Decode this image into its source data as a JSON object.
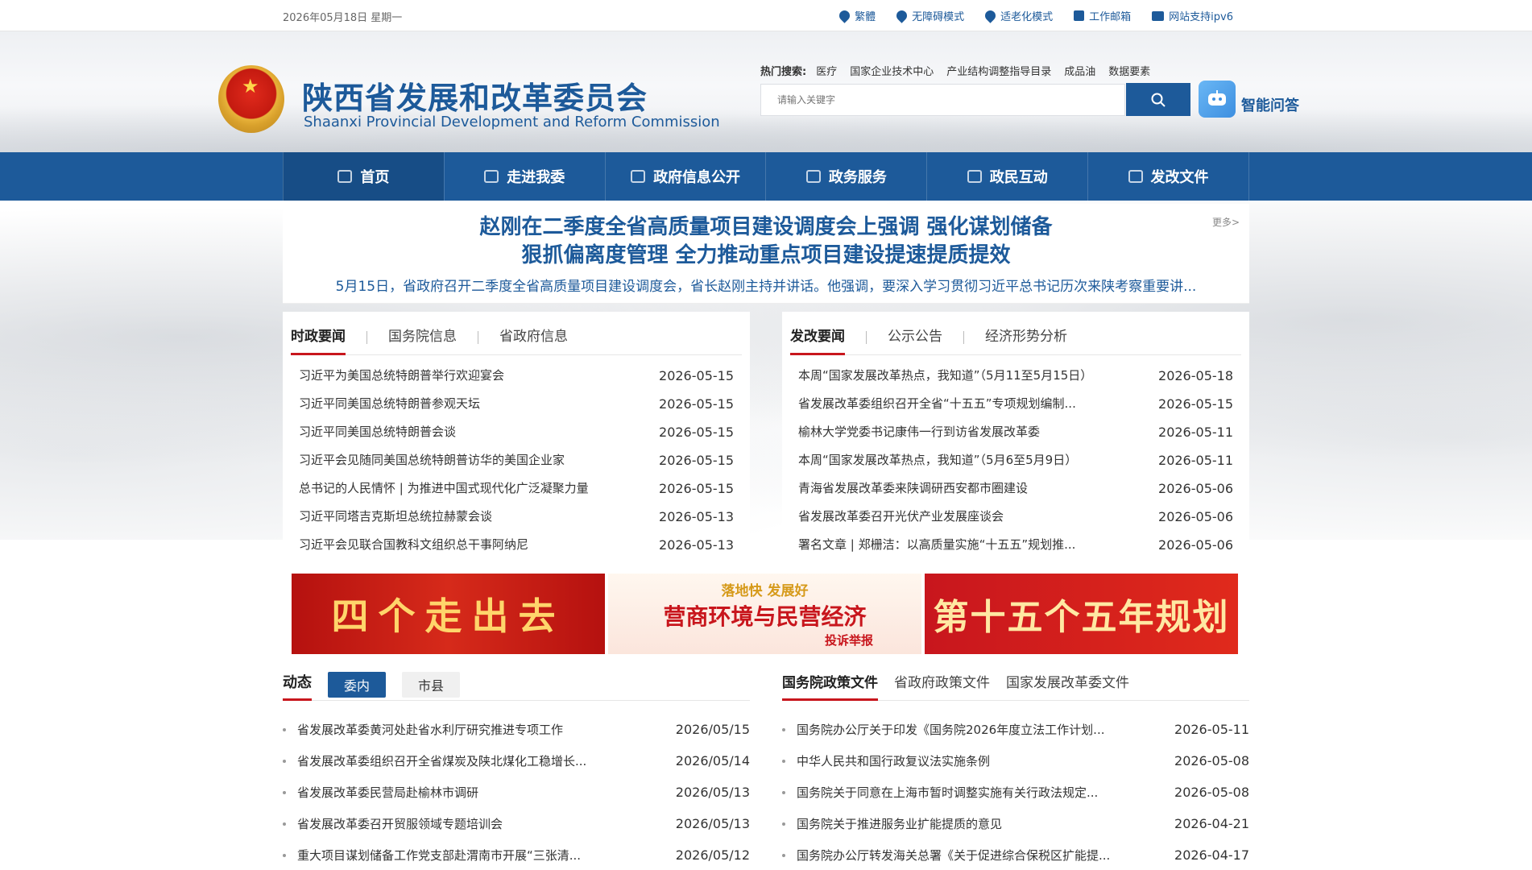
{
  "topbar": {
    "date": "2026年05月18日 星期一",
    "utils": [
      {
        "label": "繁體",
        "icon": "location-pin-icon"
      },
      {
        "label": "无障碍模式",
        "icon": "location-pin-icon"
      },
      {
        "label": "适老化模式",
        "icon": "location-pin-icon"
      },
      {
        "label": "工作邮箱",
        "icon": "mailbox-icon"
      },
      {
        "label": "网站支持ipv6",
        "icon": "monitor-icon"
      }
    ]
  },
  "header": {
    "title": "陕西省发展和改革委员会",
    "subtitle": "Shaanxi Provincial Development and Reform Commission",
    "hot_label": "热门搜索:",
    "hot_terms": [
      "医疗",
      "国家企业技术中心",
      "产业结构调整指导目录",
      "成品油",
      "数据要素"
    ],
    "search_placeholder": "请输入关键字",
    "ai_label": "智能问答"
  },
  "nav": {
    "items": [
      {
        "label": "首页",
        "icon": "home-icon"
      },
      {
        "label": "走进我委",
        "icon": "building-icon"
      },
      {
        "label": "政府信息公开",
        "icon": "document-icon"
      },
      {
        "label": "政务服务",
        "icon": "service-icon"
      },
      {
        "label": "政民互动",
        "icon": "chat-icon"
      },
      {
        "label": "发改文件",
        "icon": "file-icon"
      }
    ]
  },
  "headline": {
    "line1": "赵刚在二季度全省高质量项目建设调度会上强调 强化谋划储备",
    "line2": "狠抓偏离度管理 全力推动重点项目建设提速提质提效",
    "summary": "5月15日，省政府召开二季度全省高质量项目建设调度会，省长赵刚主持并讲话。他强调，要深入学习贯彻习近平总书记历次来陕考察重要讲...",
    "more": "更多>"
  },
  "left_panel": {
    "tabs": [
      "时政要闻",
      "国务院信息",
      "省政府信息"
    ],
    "items": [
      {
        "title": "习近平为美国总统特朗普举行欢迎宴会",
        "date": "2026-05-15"
      },
      {
        "title": "习近平同美国总统特朗普参观天坛",
        "date": "2026-05-15"
      },
      {
        "title": "习近平同美国总统特朗普会谈",
        "date": "2026-05-15"
      },
      {
        "title": "习近平会见随同美国总统特朗普访华的美国企业家",
        "date": "2026-05-15"
      },
      {
        "title": "总书记的人民情怀 | 为推进中国式现代化广泛凝聚力量",
        "date": "2026-05-15"
      },
      {
        "title": "习近平同塔吉克斯坦总统拉赫蒙会谈",
        "date": "2026-05-13"
      },
      {
        "title": "习近平会见联合国教科文组织总干事阿纳尼",
        "date": "2026-05-13"
      }
    ]
  },
  "right_panel": {
    "tabs": [
      "发改要闻",
      "公示公告",
      "经济形势分析"
    ],
    "items": [
      {
        "title": "本周“国家发展改革热点，我知道”（5月11至5月15日）",
        "date": "2026-05-18"
      },
      {
        "title": "省发展改革委组织召开全省“十五五”专项规划编制...",
        "date": "2026-05-15"
      },
      {
        "title": "榆林大学党委书记康伟一行到访省发展改革委",
        "date": "2026-05-11"
      },
      {
        "title": "本周“国家发展改革热点，我知道”（5月6至5月9日）",
        "date": "2026-05-11"
      },
      {
        "title": "青海省发展改革委来陕调研西安都市圈建设",
        "date": "2026-05-06"
      },
      {
        "title": "省发展改革委召开光伏产业发展座谈会",
        "date": "2026-05-06"
      },
      {
        "title": "署名文章 | 郑栅洁：以高质量实施“十五五”规划推...",
        "date": "2026-05-06"
      }
    ]
  },
  "banners": {
    "b1": "四个走出去",
    "b2_top": "落地快 发展好",
    "b2_main": "营商环境与民营经济",
    "b2_sub": "投诉举报",
    "b3": "第十五个五年规划"
  },
  "dynamics": {
    "title": "动态",
    "pills": [
      "委内",
      "市县"
    ],
    "items": [
      {
        "title": "省发展改革委黄河处赴省水利厅研究推进专项工作",
        "date": "2026/05/15"
      },
      {
        "title": "省发展改革委组织召开全省煤炭及陕北煤化工稳增长...",
        "date": "2026/05/14"
      },
      {
        "title": "省发展改革委民营局赴榆林市调研",
        "date": "2026/05/13"
      },
      {
        "title": "省发展改革委召开贸服领域专题培训会",
        "date": "2026/05/13"
      },
      {
        "title": "重大项目谋划储备工作党支部赴渭南市开展“三张清...",
        "date": "2026/05/12"
      }
    ]
  },
  "policy": {
    "tabs": [
      "国务院政策文件",
      "省政府政策文件",
      "国家发展改革委文件"
    ],
    "items": [
      {
        "title": "国务院办公厅关于印发《国务院2026年度立法工作计划...",
        "date": "2026-05-11"
      },
      {
        "title": "中华人民共和国行政复议法实施条例",
        "date": "2026-05-08"
      },
      {
        "title": "国务院关于同意在上海市暂时调整实施有关行政法规定...",
        "date": "2026-05-08"
      },
      {
        "title": "国务院关于推进服务业扩能提质的意见",
        "date": "2026-04-21"
      },
      {
        "title": "国务院办公厅转发海关总署《关于促进综合保税区扩能提...",
        "date": "2026-04-17"
      }
    ]
  }
}
